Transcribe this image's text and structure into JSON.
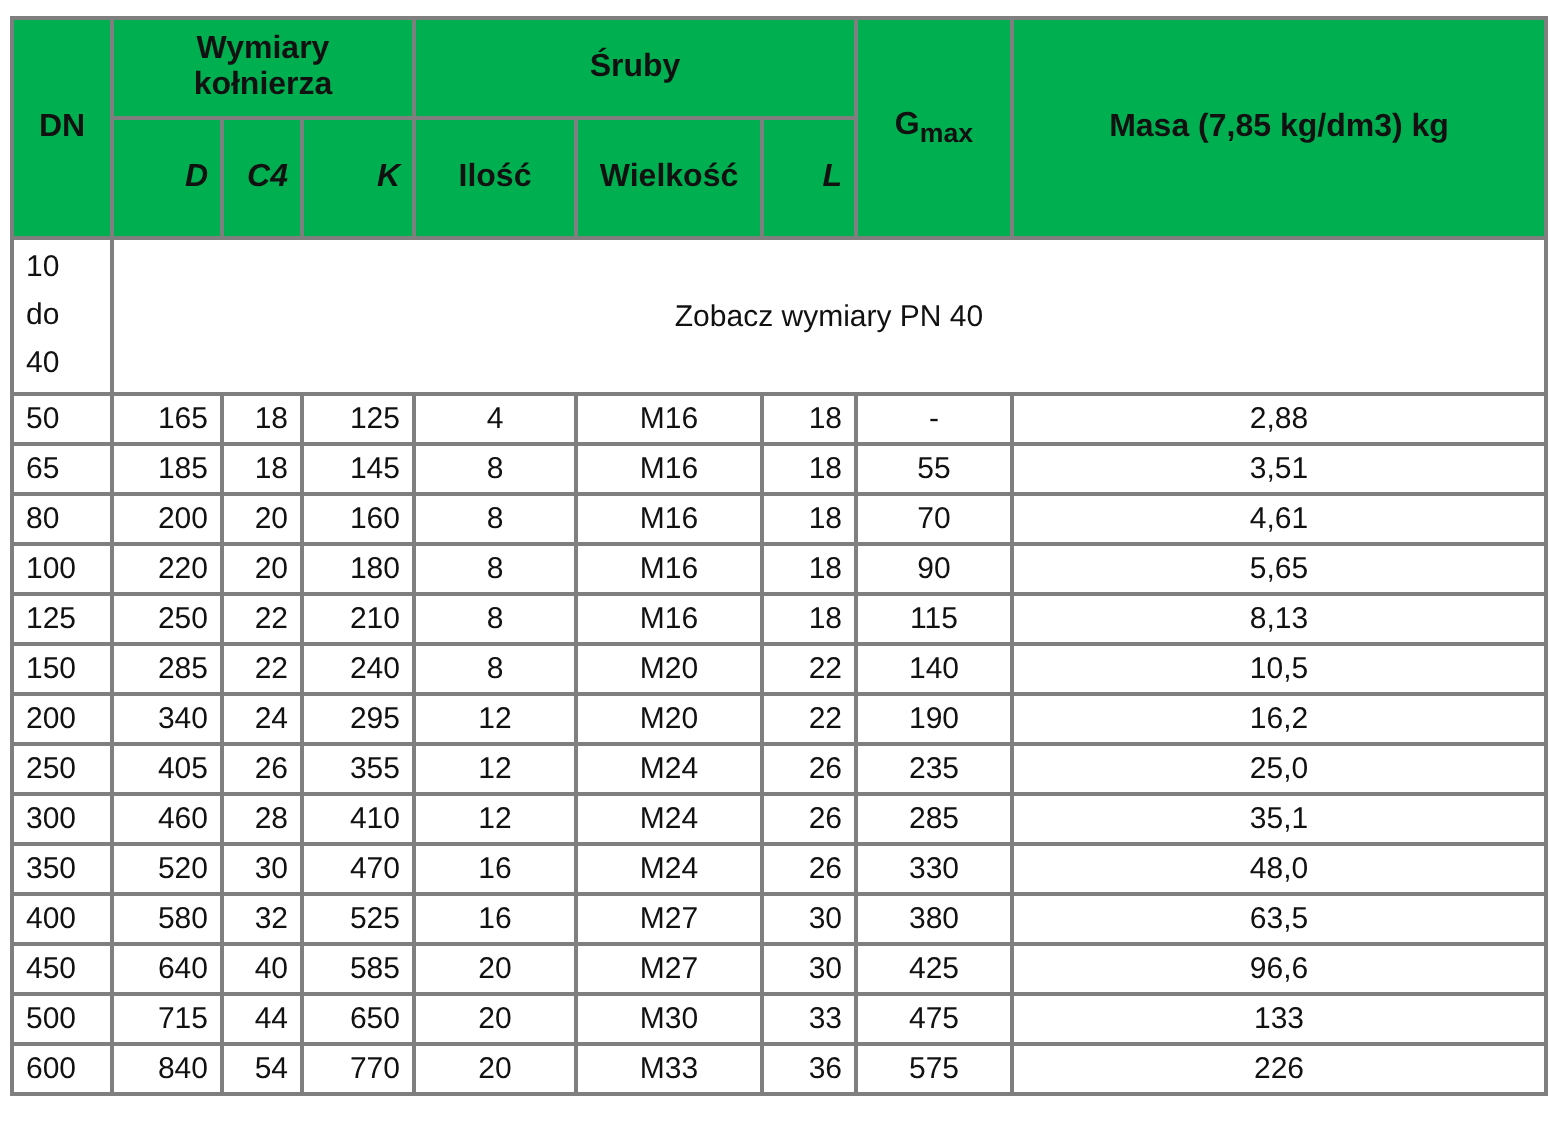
{
  "table": {
    "header": {
      "dn": "DN",
      "flange": {
        "label": "Wymiary kołnierza",
        "columns": [
          "D",
          "C4",
          "K"
        ]
      },
      "bolts": {
        "label": "Śruby",
        "columns": [
          "Ilość",
          "Wielkość",
          "L"
        ]
      },
      "gmax": "G$_{max}$",
      "mass": "Masa (7,85 kg/dm3) kg"
    },
    "note_row": {
      "dn": "10 do 40",
      "text": "Zobacz wymiary PN 40"
    },
    "rows": [
      [
        "50",
        "165",
        "18",
        "125",
        "4",
        "M16",
        "18",
        "-",
        "2,88"
      ],
      [
        "65",
        "185",
        "18",
        "145",
        "8",
        "M16",
        "18",
        "55",
        "3,51"
      ],
      [
        "80",
        "200",
        "20",
        "160",
        "8",
        "M16",
        "18",
        "70",
        "4,61"
      ],
      [
        "100",
        "220",
        "20",
        "180",
        "8",
        "M16",
        "18",
        "90",
        "5,65"
      ],
      [
        "125",
        "250",
        "22",
        "210",
        "8",
        "M16",
        "18",
        "115",
        "8,13"
      ],
      [
        "150",
        "285",
        "22",
        "240",
        "8",
        "M20",
        "22",
        "140",
        "10,5"
      ],
      [
        "200",
        "340",
        "24",
        "295",
        "12",
        "M20",
        "22",
        "190",
        "16,2"
      ],
      [
        "250",
        "405",
        "26",
        "355",
        "12",
        "M24",
        "26",
        "235",
        "25,0"
      ],
      [
        "300",
        "460",
        "28",
        "410",
        "12",
        "M24",
        "26",
        "285",
        "35,1"
      ],
      [
        "350",
        "520",
        "30",
        "470",
        "16",
        "M24",
        "26",
        "330",
        "48,0"
      ],
      [
        "400",
        "580",
        "32",
        "525",
        "16",
        "M27",
        "30",
        "380",
        "63,5"
      ],
      [
        "450",
        "640",
        "40",
        "585",
        "20",
        "M27",
        "30",
        "425",
        "96,6"
      ],
      [
        "500",
        "715",
        "44",
        "650",
        "20",
        "M30",
        "33",
        "475",
        "133"
      ],
      [
        "600",
        "840",
        "54",
        "770",
        "20",
        "M33",
        "36",
        "575",
        "226"
      ]
    ]
  }
}
